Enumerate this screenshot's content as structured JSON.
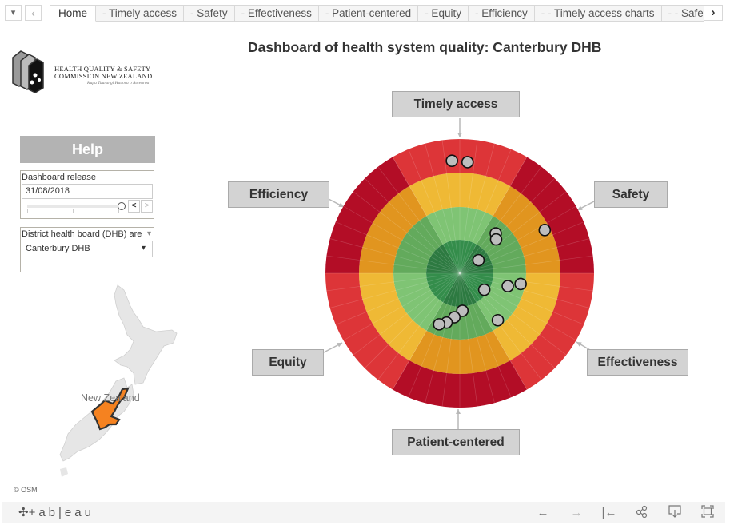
{
  "tabbar": {
    "menu_icon": "▾",
    "prev_icon": "‹",
    "next_icon": "›",
    "tabs": [
      {
        "label": "Home",
        "active": true
      },
      {
        "label": "- Timely access"
      },
      {
        "label": "- Safety"
      },
      {
        "label": "- Effectiveness"
      },
      {
        "label": "- Patient-centered"
      },
      {
        "label": "- Equity"
      },
      {
        "label": "- Efficiency"
      },
      {
        "label": "- - Timely access charts"
      },
      {
        "label": "- - Safety charts"
      }
    ]
  },
  "logo": {
    "line1": "HEALTH QUALITY & SAFETY",
    "line2": "COMMISSION NEW ZEALAND",
    "line3": "Kupu Taurangi Hauora o Aotearoa"
  },
  "sidebar": {
    "help_label": "Help",
    "release": {
      "title": "Dashboard release",
      "value": "31/08/2018",
      "slider_position": 1.0,
      "prev_icon": "<",
      "next_icon": ">"
    },
    "dhb": {
      "title": "District health board (DHB) are",
      "value": "Canterbury DHB",
      "dropdown_icon": "▾"
    },
    "map": {
      "label": "New Zealand",
      "highlighted_region": "Canterbury DHB",
      "highlight_color": "#f58220",
      "attribution": "© OSM"
    }
  },
  "colors": {
    "dark_red": "#b30d26",
    "red": "#dd3538",
    "orange": "#e1951f",
    "yellow": "#efb935",
    "green_dark_sector": "#63aa5c",
    "green_light_sector": "#7fc474",
    "center_dark": "#2d7a41",
    "center_light": "#348d4b",
    "dot_fill": "#bdbdbd",
    "dot_stroke": "#111111"
  },
  "chart_data": {
    "type": "scatter",
    "subtype": "polar-target",
    "title": "Dashboard of health system quality: Canterbury DHB",
    "rings_inner_to_outer": [
      "best (dark green)",
      "good (green)",
      "fair (orange/yellow)",
      "poor (red)"
    ],
    "sectors": [
      {
        "name": "Timely access",
        "angle_center_deg": 0
      },
      {
        "name": "Safety",
        "angle_center_deg": 60
      },
      {
        "name": "Effectiveness",
        "angle_center_deg": 120
      },
      {
        "name": "Patient-centered",
        "angle_center_deg": 180
      },
      {
        "name": "Equity",
        "angle_center_deg": 240
      },
      {
        "name": "Efficiency",
        "angle_center_deg": 300
      }
    ],
    "points_note": "angle in degrees clockwise from top; r as fraction of outer radius (0=center, 1=edge)",
    "points": [
      {
        "angle": -4,
        "r": 0.84
      },
      {
        "angle": 4,
        "r": 0.83
      },
      {
        "angle": 63,
        "r": 0.71
      },
      {
        "angle": 42,
        "r": 0.4
      },
      {
        "angle": 47,
        "r": 0.37
      },
      {
        "angle": 55,
        "r": 0.17
      },
      {
        "angle": 100,
        "r": 0.46
      },
      {
        "angle": 105,
        "r": 0.37
      },
      {
        "angle": 124,
        "r": 0.22
      },
      {
        "angle": 141,
        "r": 0.45
      },
      {
        "angle": 176,
        "r": 0.28
      },
      {
        "angle": 187,
        "r": 0.33
      },
      {
        "angle": 195,
        "r": 0.38
      },
      {
        "angle": 202,
        "r": 0.41
      }
    ]
  },
  "footer": {
    "brand": "+ab|eau",
    "icons": [
      "undo-icon",
      "redo-icon",
      "revert-icon",
      "share-icon",
      "download-icon",
      "fullscreen-icon"
    ]
  }
}
